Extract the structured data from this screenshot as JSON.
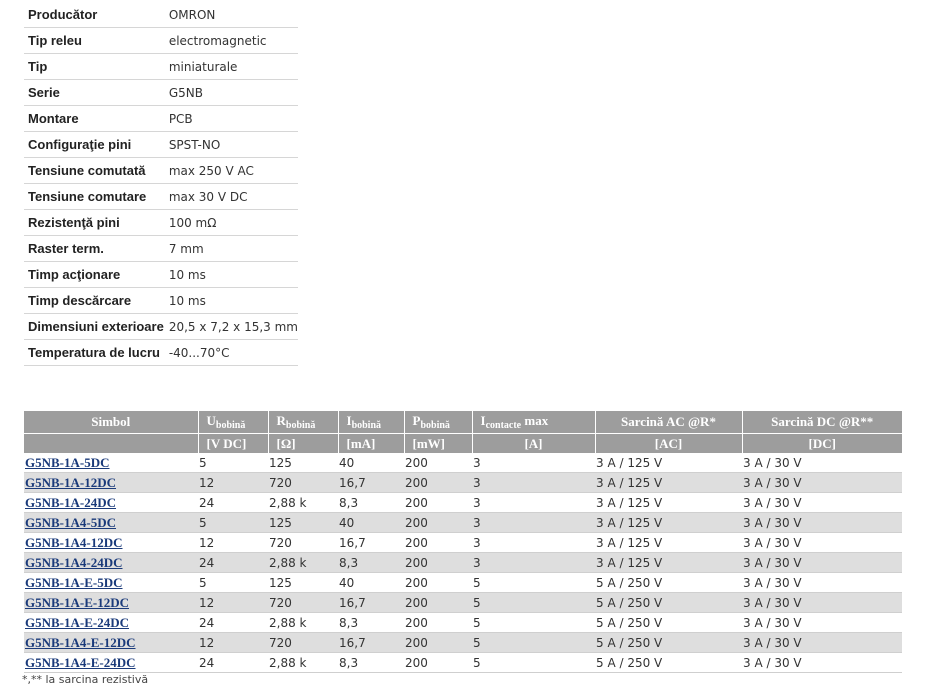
{
  "specs": [
    {
      "label": "Producător",
      "value": "OMRON"
    },
    {
      "label": "Tip releu",
      "value": "electromagnetic"
    },
    {
      "label": "Tip",
      "value": "miniaturale"
    },
    {
      "label": "Serie",
      "value": "G5NB"
    },
    {
      "label": "Montare",
      "value": "PCB"
    },
    {
      "label": "Configuraţie pini",
      "value": "SPST-NO"
    },
    {
      "label": "Tensiune comutată",
      "value": "max 250 V AC"
    },
    {
      "label": "Tensiune comutare",
      "value": "max 30 V DC"
    },
    {
      "label": "Rezistenţă pini",
      "value": "100 mΩ"
    },
    {
      "label": "Raster term.",
      "value": "7 mm"
    },
    {
      "label": "Timp acţionare",
      "value": "10 ms"
    },
    {
      "label": "Timp descărcare",
      "value": "10 ms"
    },
    {
      "label": "Dimensiuni exterioare",
      "value": "20,5 x 7,2 x 15,3 mm"
    },
    {
      "label": "Temperatura de lucru",
      "value": "-40...70°C"
    }
  ],
  "products": {
    "headers": {
      "symbol": "Simbol",
      "u": {
        "main": "U",
        "sub": "bobină"
      },
      "r": {
        "main": "R",
        "sub": "bobină"
      },
      "i": {
        "main": "I",
        "sub": "bobină"
      },
      "p": {
        "main": "P",
        "sub": "bobină"
      },
      "ic": {
        "main": "I",
        "sub": "contacte",
        "tail": " max"
      },
      "ac": "Sarcină AC @R*",
      "dc": "Sarcină DC @R**"
    },
    "units": {
      "u": "[V DC]",
      "r": "[Ω]",
      "i": "[mA]",
      "p": "[mW]",
      "ic": "[A]",
      "ac": "[AC]",
      "dc": "[DC]"
    },
    "rows": [
      {
        "symbol": "G5NB-1A-5DC",
        "u": "5",
        "r": "125",
        "i": "40",
        "p": "200",
        "ic": "3",
        "ac": "3 A / 125 V",
        "dc": "3 A / 30 V"
      },
      {
        "symbol": "G5NB-1A-12DC",
        "u": "12",
        "r": "720",
        "i": "16,7",
        "p": "200",
        "ic": "3",
        "ac": "3 A / 125 V",
        "dc": "3 A / 30 V"
      },
      {
        "symbol": "G5NB-1A-24DC",
        "u": "24",
        "r": "2,88 k",
        "i": "8,3",
        "p": "200",
        "ic": "3",
        "ac": "3 A / 125 V",
        "dc": "3 A / 30 V"
      },
      {
        "symbol": "G5NB-1A4-5DC",
        "u": "5",
        "r": "125",
        "i": "40",
        "p": "200",
        "ic": "3",
        "ac": "3 A / 125 V",
        "dc": "3 A / 30 V"
      },
      {
        "symbol": "G5NB-1A4-12DC",
        "u": "12",
        "r": "720",
        "i": "16,7",
        "p": "200",
        "ic": "3",
        "ac": "3 A / 125 V",
        "dc": "3 A / 30 V"
      },
      {
        "symbol": "G5NB-1A4-24DC",
        "u": "24",
        "r": "2,88 k",
        "i": "8,3",
        "p": "200",
        "ic": "3",
        "ac": "3 A / 125 V",
        "dc": "3 A / 30 V"
      },
      {
        "symbol": "G5NB-1A-E-5DC",
        "u": "5",
        "r": "125",
        "i": "40",
        "p": "200",
        "ic": "5",
        "ac": "5 A / 250 V",
        "dc": "3 A / 30 V"
      },
      {
        "symbol": "G5NB-1A-E-12DC",
        "u": "12",
        "r": "720",
        "i": "16,7",
        "p": "200",
        "ic": "5",
        "ac": "5 A / 250 V",
        "dc": "3 A / 30 V"
      },
      {
        "symbol": "G5NB-1A-E-24DC",
        "u": "24",
        "r": "2,88 k",
        "i": "8,3",
        "p": "200",
        "ic": "5",
        "ac": "5 A / 250 V",
        "dc": "3 A / 30 V"
      },
      {
        "symbol": "G5NB-1A4-E-12DC",
        "u": "12",
        "r": "720",
        "i": "16,7",
        "p": "200",
        "ic": "5",
        "ac": "5 A / 250 V",
        "dc": "3 A / 30 V"
      },
      {
        "symbol": "G5NB-1A4-E-24DC",
        "u": "24",
        "r": "2,88 k",
        "i": "8,3",
        "p": "200",
        "ic": "5",
        "ac": "5 A / 250 V",
        "dc": "3 A / 30 V"
      }
    ]
  },
  "footnote": "*,** la sarcina rezistivă",
  "colors": {
    "header_bg": "#9d9d9d",
    "link": "#1a3a7a",
    "stripe": "#dedede"
  }
}
